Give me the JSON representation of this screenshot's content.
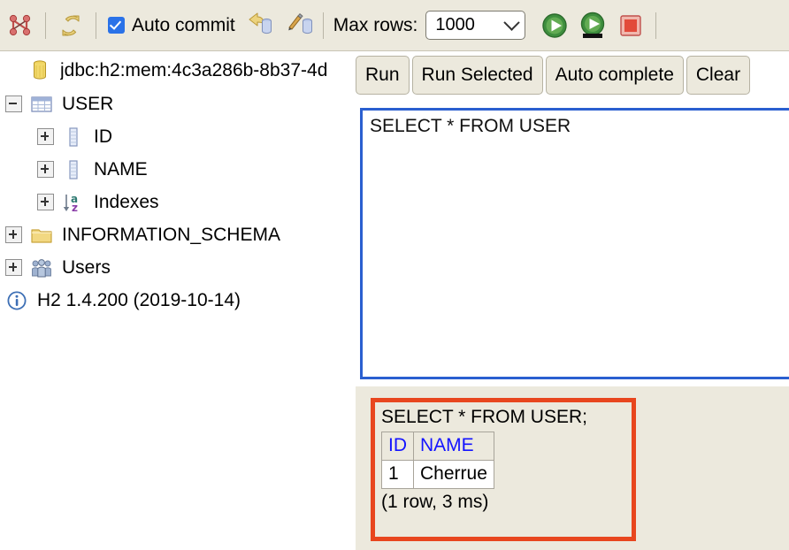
{
  "toolbar": {
    "icons": [
      {
        "name": "connection-icon",
        "label": "Connection"
      },
      {
        "name": "refresh-icon",
        "label": "Refresh"
      }
    ],
    "auto_commit": {
      "label": "Auto commit",
      "checked": true,
      "checkbox_color": "#2a72e8"
    },
    "rollback_icon_label": "Rollback",
    "commit_icon_label": "Commit",
    "max_rows_label": "Max rows:",
    "max_rows_value": "1000",
    "max_rows_options": [
      "1000"
    ],
    "run_icon_label": "Run",
    "run_selected_icon_label": "Run Selected",
    "stop_icon_label": "Stop",
    "background": "#ece9dd"
  },
  "tree": {
    "connection": {
      "label": "jdbc:h2:mem:4c3a286b-8b37-4d",
      "icon": "database-icon"
    },
    "nodes": [
      {
        "label": "USER",
        "icon": "table-icon",
        "toggle": "minus",
        "indent": 1
      },
      {
        "label": "ID",
        "icon": "column-icon",
        "toggle": "plus",
        "indent": 2
      },
      {
        "label": "NAME",
        "icon": "column-icon",
        "toggle": "plus",
        "indent": 2
      },
      {
        "label": "Indexes",
        "icon": "index-sort-icon",
        "toggle": "plus",
        "indent": 2
      },
      {
        "label": "INFORMATION_SCHEMA",
        "icon": "folder-icon",
        "toggle": "plus",
        "indent": 1
      },
      {
        "label": "Users",
        "icon": "users-icon",
        "toggle": "plus",
        "indent": 1
      }
    ],
    "version": {
      "label": "H2 1.4.200 (2019-10-14)",
      "icon": "info-icon"
    }
  },
  "editor": {
    "buttons": [
      {
        "name": "run-button",
        "label": "Run"
      },
      {
        "name": "run-selected-button",
        "label": "Run Selected"
      },
      {
        "name": "auto-complete-button",
        "label": "Auto complete"
      },
      {
        "name": "clear-button",
        "label": "Clear"
      }
    ],
    "sql_value": "SELECT * FROM USER",
    "border_color": "#2a5fd0"
  },
  "results": {
    "highlight_color": "#e8461e",
    "query_echo": "SELECT * FROM USER;",
    "columns": [
      "ID",
      "NAME"
    ],
    "rows": [
      [
        "1",
        "Cherrue"
      ]
    ],
    "status": "(1 row, 3 ms)",
    "header_text_color": "#1414ff"
  }
}
